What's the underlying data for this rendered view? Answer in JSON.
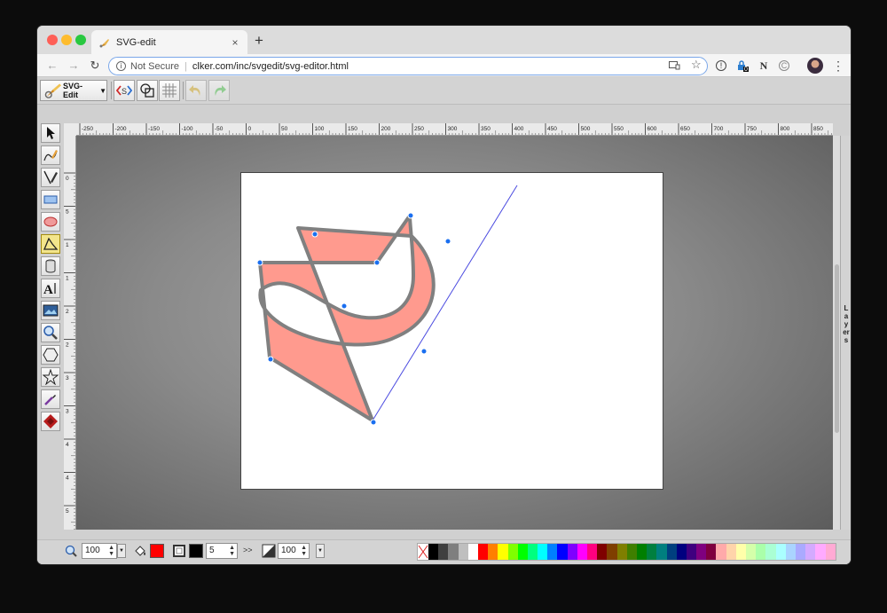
{
  "browser": {
    "tab_title": "SVG-edit",
    "security_label": "Not Secure",
    "url": "clker.com/inc/svgedit/svg-editor.html",
    "new_tab_symbol": "+",
    "close_symbol": "×",
    "ext_badge": "0"
  },
  "app": {
    "logo_label": "SVG-Edit",
    "layers_label": "Layers",
    "ruler_top_labels": [
      "-250",
      "-200",
      "-150",
      "-100",
      "-50",
      "0",
      "50",
      "100",
      "150",
      "200",
      "250",
      "300",
      "350",
      "400",
      "450",
      "500",
      "550",
      "600",
      "650",
      "700",
      "750",
      "800",
      "850"
    ],
    "ruler_left_labels": [
      "0",
      "5",
      "1",
      "1",
      "2",
      "2",
      "3",
      "3",
      "4",
      "4",
      "5"
    ],
    "zoom_value": "100",
    "stroke_width": "5",
    "opacity_value": "100",
    "fill_color": "#ff0000",
    "stroke_color": "#000000",
    "shape_fill": "#ff9a8e",
    "shape_stroke": "#808080",
    "handle_color": "#1a6ff0",
    "palette": [
      "#000000",
      "#3f3f3f",
      "#7f7f7f",
      "#bfbfbf",
      "#ffffff",
      "#ff0000",
      "#ff7f00",
      "#ffff00",
      "#7fff00",
      "#00ff00",
      "#00ff7f",
      "#00ffff",
      "#007fff",
      "#0000ff",
      "#7f00ff",
      "#ff00ff",
      "#ff007f",
      "#7f0000",
      "#7f3f00",
      "#7f7f00",
      "#3f7f00",
      "#007f00",
      "#007f3f",
      "#007f7f",
      "#003f7f",
      "#00007f",
      "#3f007f",
      "#7f007f",
      "#7f003f",
      "#ffaaaa",
      "#ffd4aa",
      "#ffffaa",
      "#d4ffaa",
      "#aaffaa",
      "#aaffd4",
      "#aaffff",
      "#aad4ff",
      "#aaaaff",
      "#d4aaff",
      "#ffaaff",
      "#ffaad4"
    ]
  }
}
